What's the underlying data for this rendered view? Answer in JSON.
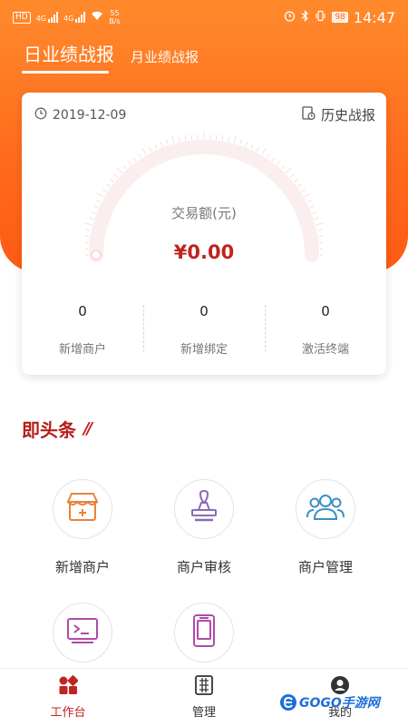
{
  "status_bar": {
    "left_chip": "HD",
    "signal1": "4G",
    "signal2": "4G",
    "speed_value": "55",
    "speed_unit": "B/s",
    "battery": "98",
    "time": "14:47"
  },
  "tabs": [
    {
      "label": "日业绩战报",
      "active": true
    },
    {
      "label": "月业绩战报",
      "active": false
    }
  ],
  "report": {
    "date": "2019-12-09",
    "history_label": "历史战报",
    "gauge_label": "交易额(元)",
    "gauge_value": "¥0.00",
    "stats": [
      {
        "value": "0",
        "label": "新增商户"
      },
      {
        "value": "0",
        "label": "新增绑定"
      },
      {
        "value": "0",
        "label": "激活终端"
      }
    ]
  },
  "headline": {
    "title": "即头条",
    "mark": "//"
  },
  "apps": [
    {
      "label": "新增商户",
      "icon": "store-add-icon",
      "color": "#e8833a"
    },
    {
      "label": "商户审核",
      "icon": "stamp-icon",
      "color": "#8a6bb8"
    },
    {
      "label": "商户管理",
      "icon": "users-group-icon",
      "color": "#3d8fc4"
    },
    {
      "label": "",
      "icon": "terminal-icon",
      "color": "#b04aa8"
    },
    {
      "label": "",
      "icon": "device-icon",
      "color": "#b04aa8"
    }
  ],
  "tab_bar": [
    {
      "label": "工作台",
      "icon": "dashboard-icon",
      "active": true
    },
    {
      "label": "管理",
      "icon": "grid-icon",
      "active": false
    },
    {
      "label": "我的",
      "icon": "user-icon",
      "active": false
    }
  ],
  "watermark": {
    "text": "GOGO手游网"
  },
  "colors": {
    "brand_orange": "#ff6a1c",
    "accent_red": "#c0241f"
  }
}
